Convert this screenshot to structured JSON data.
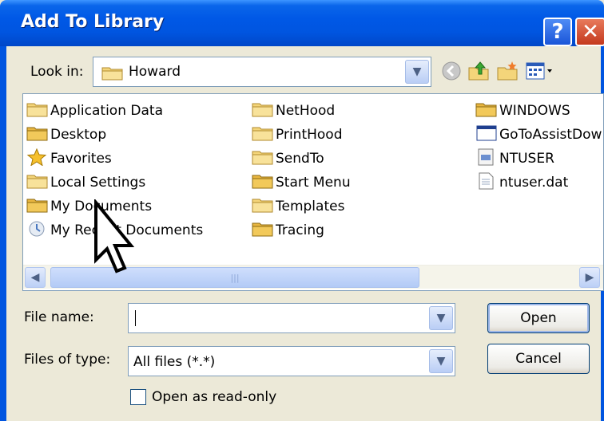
{
  "window": {
    "title": "Add To Library",
    "help_label": "?",
    "close_label": "✕"
  },
  "lookin": {
    "label": "Look in:",
    "value": "Howard"
  },
  "files": [
    {
      "name": "Application Data",
      "icon": "folder-icon"
    },
    {
      "name": "Desktop",
      "icon": "desktop-folder-icon"
    },
    {
      "name": "Favorites",
      "icon": "favorites-star-icon"
    },
    {
      "name": "Local Settings",
      "icon": "folder-icon"
    },
    {
      "name": "My Documents",
      "icon": "my-documents-folder-icon"
    },
    {
      "name": "My Recent Documents",
      "icon": "recent-documents-icon"
    },
    {
      "name": "NetHood",
      "icon": "folder-icon"
    },
    {
      "name": "PrintHood",
      "icon": "folder-icon"
    },
    {
      "name": "SendTo",
      "icon": "folder-icon"
    },
    {
      "name": "Start Menu",
      "icon": "folder-icon"
    },
    {
      "name": "Templates",
      "icon": "folder-icon"
    },
    {
      "name": "Tracing",
      "icon": "folder-icon"
    },
    {
      "name": "WINDOWS",
      "icon": "folder-icon"
    },
    {
      "name": "GoToAssistDow",
      "icon": "application-icon"
    },
    {
      "name": "NTUSER",
      "icon": "system-file-icon"
    },
    {
      "name": "ntuser.dat",
      "icon": "document-icon"
    }
  ],
  "filename": {
    "label": "File name:",
    "value": ""
  },
  "filetype": {
    "label": "Files of type:",
    "value": "All files (*.*)"
  },
  "buttons": {
    "open": "Open",
    "cancel": "Cancel"
  },
  "readonly": {
    "label": "Open as read-only",
    "checked": false
  },
  "colors": {
    "titlebar": "#0055e0",
    "folder": "#f4d57a",
    "dialog_bg": "#ece9d8"
  }
}
